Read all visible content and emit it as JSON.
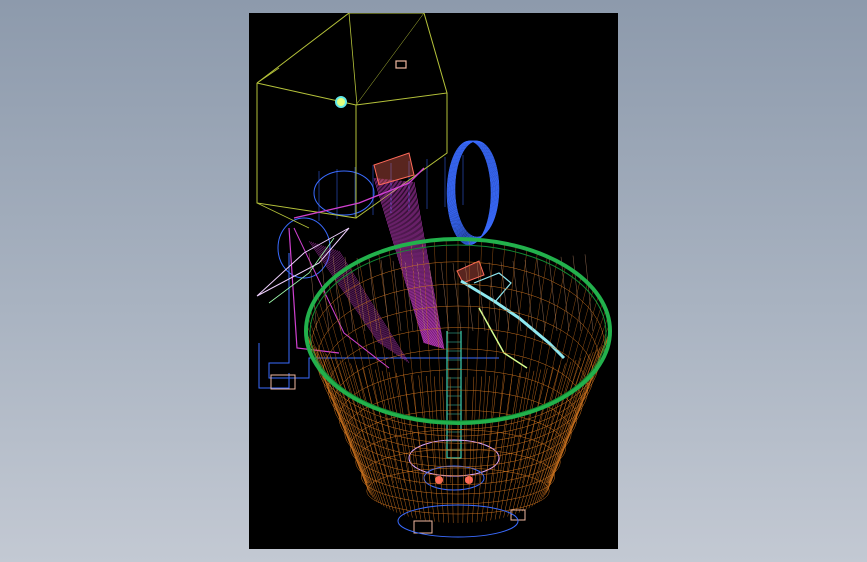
{
  "drawing": {
    "colors": {
      "background": "#000000",
      "hopper": "#b5c23a",
      "motor_housing": "#3a6bff",
      "frame": "#d040d0",
      "bowl_rim": "#22b14c",
      "bowl_mesh": "#c8701e",
      "scraper_arm": "#8ee8f0",
      "spindle": "#40d0b0",
      "feet": "#f0b8a0",
      "pulley": "#ff6a5a"
    },
    "icons": [
      "hopper-mark-icon",
      "hopper-label-icon"
    ]
  }
}
